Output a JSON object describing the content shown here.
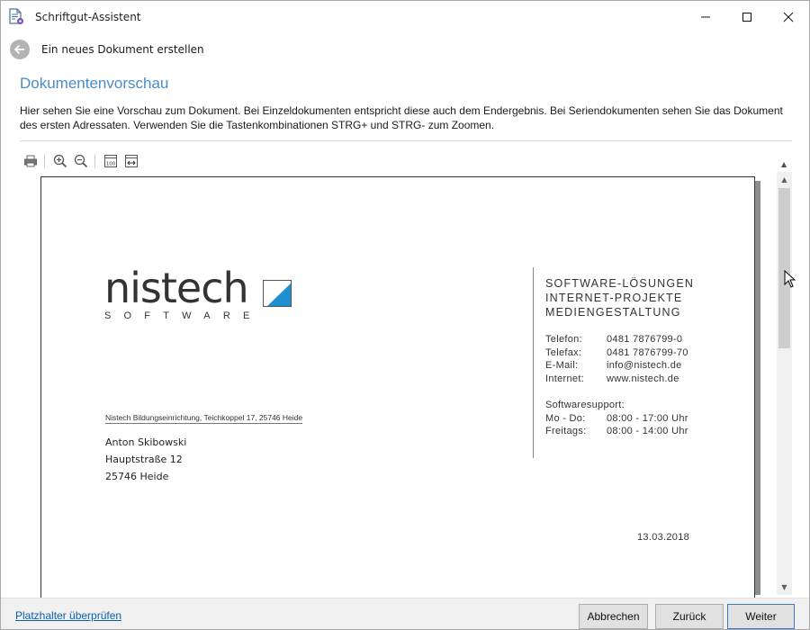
{
  "window": {
    "title": "Schriftgut-Assistent"
  },
  "nav": {
    "title": "Ein neues Dokument erstellen"
  },
  "section": {
    "heading": "Dokumentenvorschau",
    "description": "Hier sehen Sie eine Vorschau zum Dokument. Bei Einzeldokumenten entspricht diese auch dem Endergebnis. Bei Seriendokumenten sehen Sie das Dokument des ersten Adressaten. Verwenden Sie die Tastenkombinationen STRG+ und STRG- zum Zoomen."
  },
  "toolbar": {
    "icons": [
      "print-icon",
      "zoom-in-icon",
      "zoom-out-icon",
      "actual-size-icon",
      "fit-width-icon"
    ],
    "actual_size_label": "100"
  },
  "document": {
    "logo": {
      "word": "nistech",
      "sub": "SOFTWARE",
      "colors": {
        "text": "#333333",
        "accent": "#1e8fd0"
      }
    },
    "sender_line": "Nistech Bildungseinrichtung, Teichkoppel 17, 25746 Heide",
    "recipient": {
      "name": "Anton Skibowski",
      "street": "Hauptstraße 12",
      "city": "25746 Heide"
    },
    "services": [
      "SOFTWARE-LÖSUNGEN",
      "INTERNET-PROJEKTE",
      "MEDIENGESTALTUNG"
    ],
    "contact": [
      {
        "label": "Telefon:",
        "value": "0481 7876799-0"
      },
      {
        "label": "Telefax:",
        "value": "0481 7876799-70"
      },
      {
        "label": "E-Mail:",
        "value": "info@nistech.de"
      },
      {
        "label": "Internet:",
        "value": "www.nistech.de"
      }
    ],
    "support": {
      "title": "Softwaresupport:",
      "rows": [
        {
          "label": "Mo - Do:",
          "value": "08:00 - 17:00 Uhr"
        },
        {
          "label": "Freitags:",
          "value": "08:00 - 14:00 Uhr"
        }
      ]
    },
    "date": "13.03.2018"
  },
  "footer": {
    "link": "Platzhalter überprüfen",
    "cancel": "Abbrechen",
    "back": "Zurück",
    "next": "Weiter"
  },
  "colors": {
    "accent": "#4a8cc9",
    "link": "#0b5fb3",
    "primary_border": "#3a78c6"
  }
}
